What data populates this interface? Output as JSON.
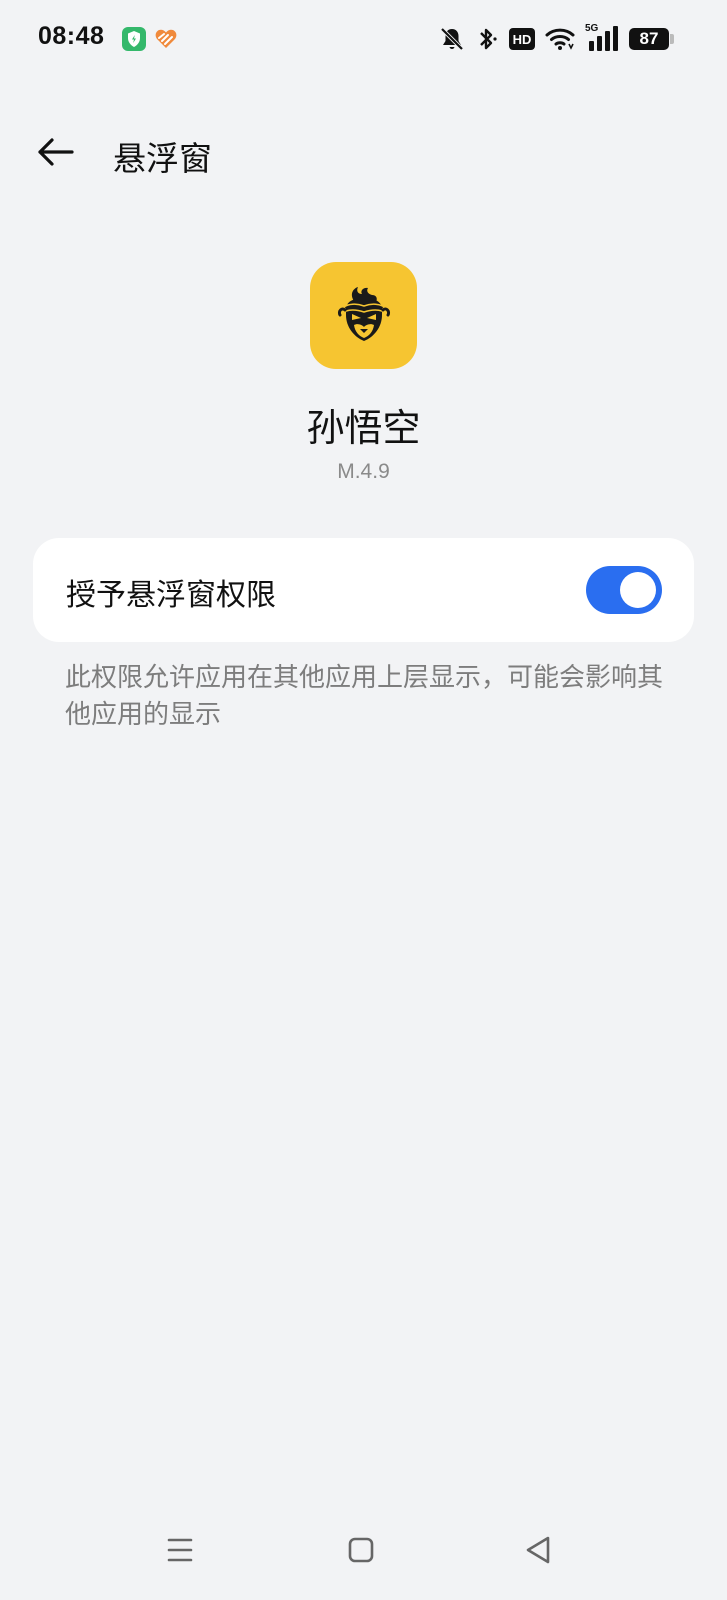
{
  "status_bar": {
    "time": "08:48",
    "hd_label": "HD",
    "network_label": "5G",
    "battery": "87",
    "icons": [
      "shield-app-icon",
      "heart-app-icon",
      "bell-off-icon",
      "bluetooth-icon",
      "hd-icon",
      "wifi-icon",
      "signal-icon",
      "battery-icon"
    ]
  },
  "header": {
    "title": "悬浮窗",
    "back_icon": "arrow-left-icon"
  },
  "app": {
    "name": "孙悟空",
    "version": "M.4.9",
    "icon_color": "#f6c531"
  },
  "permission": {
    "label": "授予悬浮窗权限",
    "enabled": true,
    "toggle_color": "#2a6ef0"
  },
  "description": "此权限允许应用在其他应用上层显示，可能会影响其他应用的显示",
  "nav_bar": {
    "icons": [
      "menu-icon",
      "home-icon",
      "back-triangle-icon"
    ]
  }
}
